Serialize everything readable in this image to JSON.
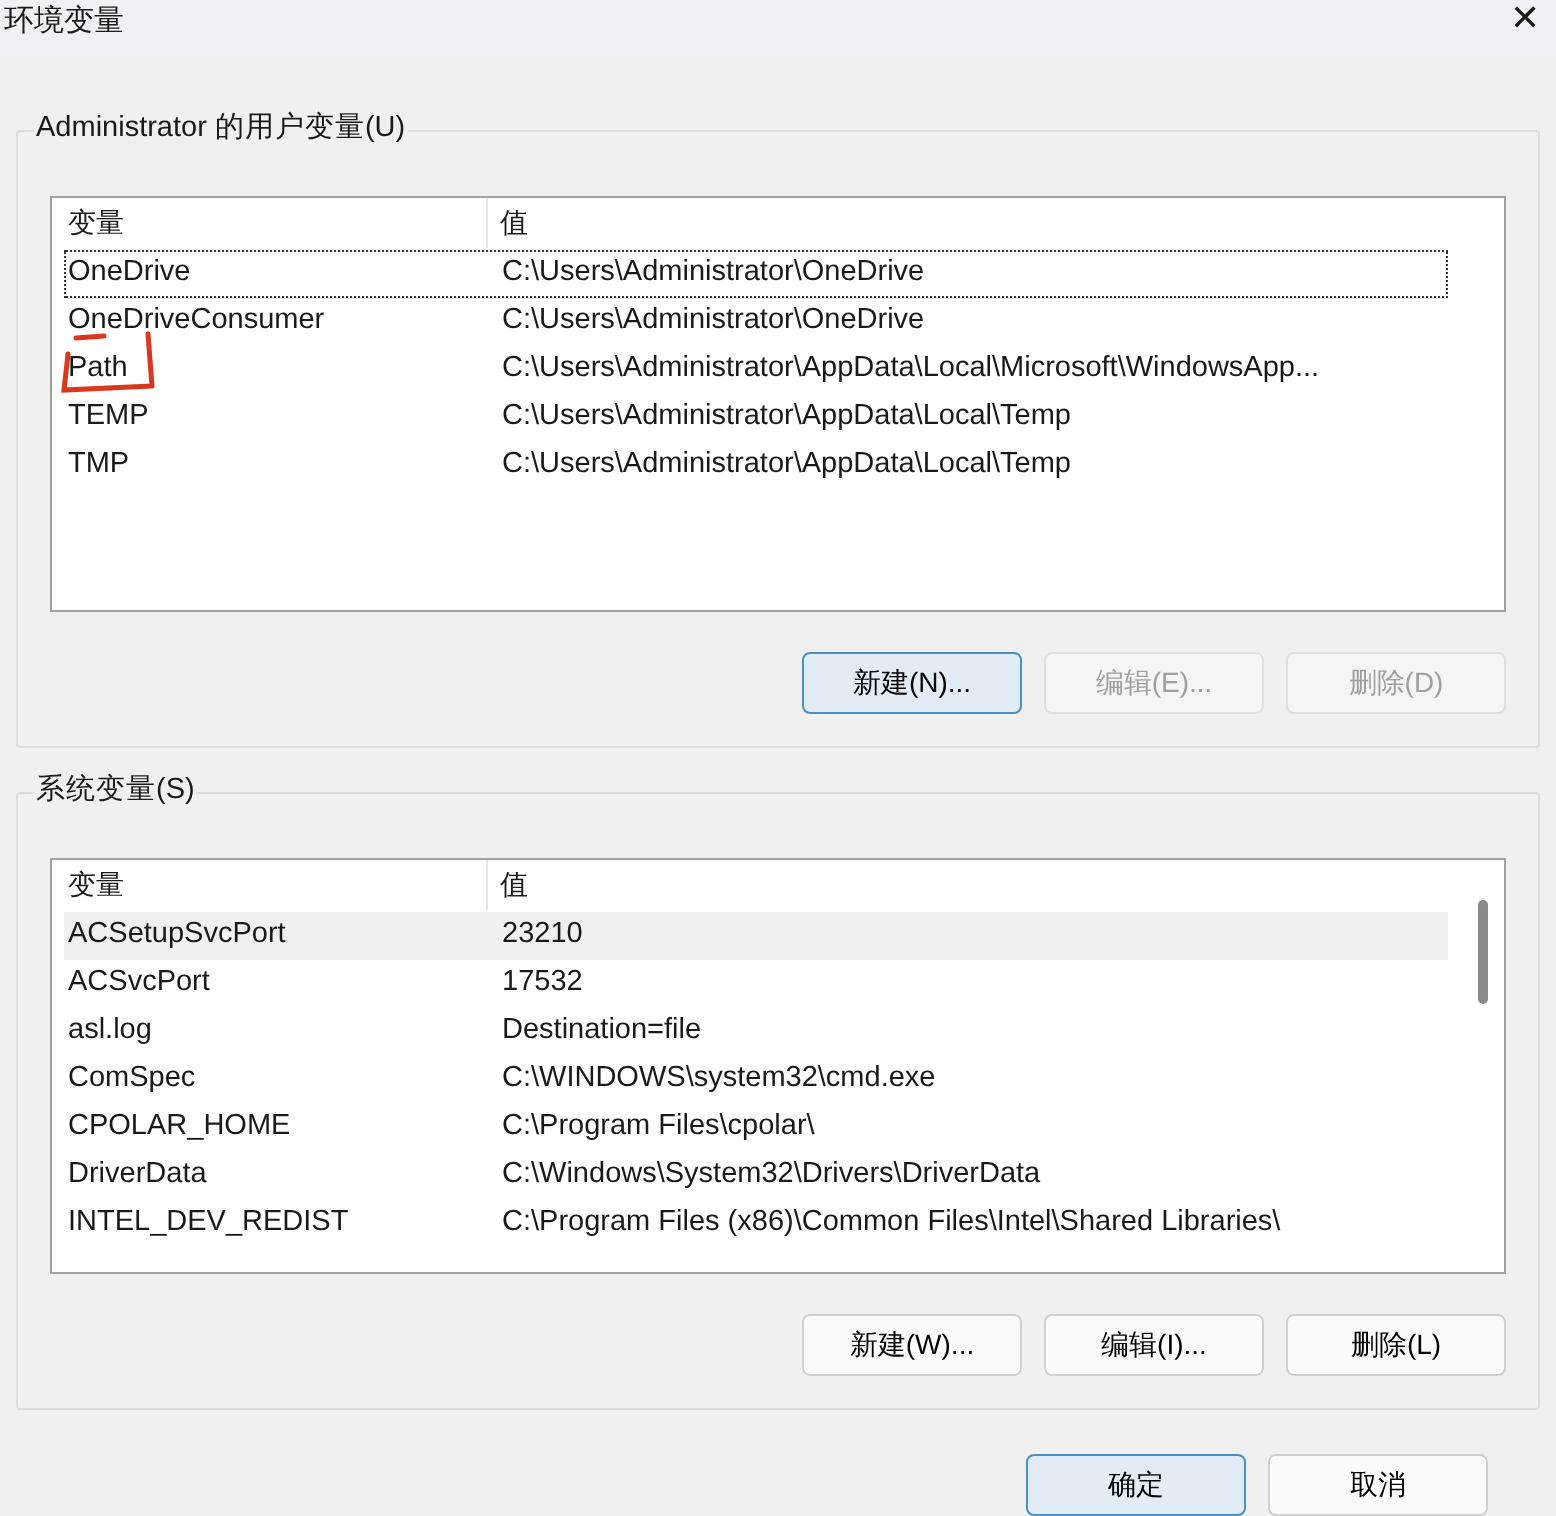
{
  "window": {
    "title": "环境变量",
    "close": "✕"
  },
  "user_vars": {
    "title": "Administrator 的用户变量(U)",
    "columns": [
      "变量",
      "值"
    ],
    "rows": [
      {
        "name": "OneDrive",
        "value": "C:\\Users\\Administrator\\OneDrive",
        "focused": true,
        "highlighted": false
      },
      {
        "name": "OneDriveConsumer",
        "value": "C:\\Users\\Administrator\\OneDrive",
        "focused": false,
        "highlighted": false
      },
      {
        "name": "Path",
        "value": "C:\\Users\\Administrator\\AppData\\Local\\Microsoft\\WindowsApp...",
        "focused": false,
        "highlighted": false,
        "annotated": true
      },
      {
        "name": "TEMP",
        "value": "C:\\Users\\Administrator\\AppData\\Local\\Temp",
        "focused": false,
        "highlighted": false
      },
      {
        "name": "TMP",
        "value": "C:\\Users\\Administrator\\AppData\\Local\\Temp",
        "focused": false,
        "highlighted": false
      }
    ],
    "buttons": [
      {
        "label": "新建(N)...",
        "disabled": false,
        "default": true
      },
      {
        "label": "编辑(E)...",
        "disabled": true,
        "default": false
      },
      {
        "label": "删除(D)",
        "disabled": true,
        "default": false
      }
    ]
  },
  "system_vars": {
    "title": "系统变量(S)",
    "columns": [
      "变量",
      "值"
    ],
    "rows": [
      {
        "name": "ACSetupSvcPort",
        "value": "23210",
        "focused": false,
        "highlighted": true
      },
      {
        "name": "ACSvcPort",
        "value": "17532",
        "focused": false,
        "highlighted": false
      },
      {
        "name": "asl.log",
        "value": "Destination=file",
        "focused": false,
        "highlighted": false
      },
      {
        "name": "ComSpec",
        "value": "C:\\WINDOWS\\system32\\cmd.exe",
        "focused": false,
        "highlighted": false
      },
      {
        "name": "CPOLAR_HOME",
        "value": "C:\\Program Files\\cpolar\\",
        "focused": false,
        "highlighted": false
      },
      {
        "name": "DriverData",
        "value": "C:\\Windows\\System32\\Drivers\\DriverData",
        "focused": false,
        "highlighted": false
      },
      {
        "name": "INTEL_DEV_REDIST",
        "value": "C:\\Program Files (x86)\\Common Files\\Intel\\Shared Libraries\\",
        "focused": false,
        "highlighted": false
      }
    ],
    "buttons": [
      {
        "label": "新建(W)...",
        "disabled": false,
        "default": false
      },
      {
        "label": "编辑(I)...",
        "disabled": false,
        "default": false
      },
      {
        "label": "删除(L)",
        "disabled": false,
        "default": false
      }
    ]
  },
  "footer_buttons": [
    {
      "label": "确定",
      "disabled": false,
      "default": true
    },
    {
      "label": "取消",
      "disabled": false,
      "default": false
    }
  ]
}
